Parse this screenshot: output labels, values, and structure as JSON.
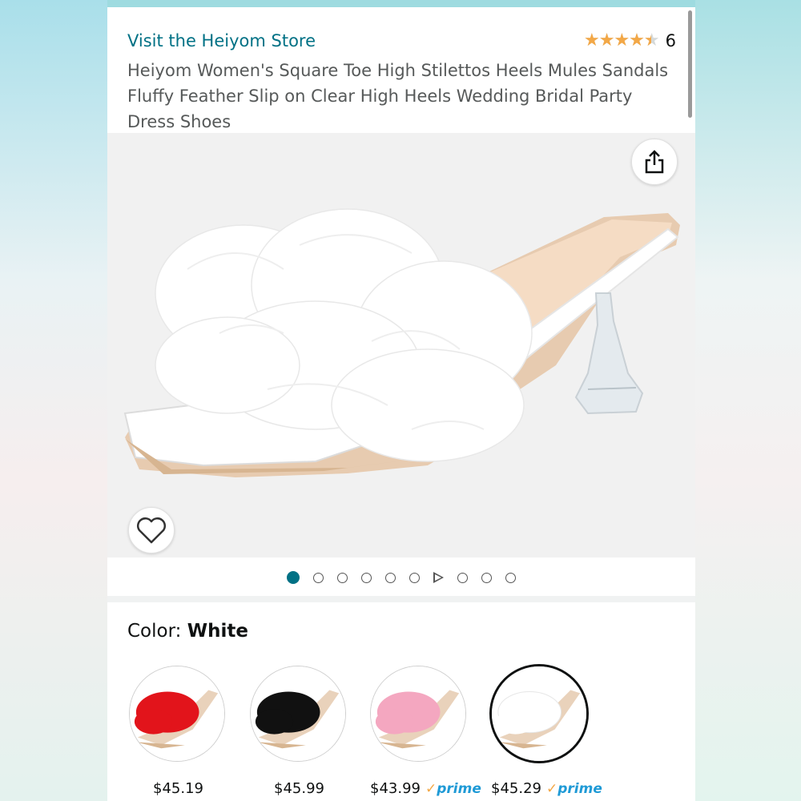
{
  "header": {
    "store_link": "Visit the Heiyom Store",
    "rating_value": 4.5,
    "rating_count": "6",
    "title": "Heiyom Women's Square Toe High Stilettos Heels Mules Sandals Fluffy Feather Slip on Clear High Heels Wedding Bridal Party Dress Shoes"
  },
  "gallery": {
    "total_slides": 10,
    "active_index": 0,
    "video_index": 6,
    "icons": {
      "share": "share-icon",
      "wishlist": "heart-icon"
    }
  },
  "color": {
    "label": "Color: ",
    "selected": "White"
  },
  "variants": [
    {
      "name": "Red",
      "price": "$45.19",
      "prime": "",
      "color": "#e2141b",
      "selected": false
    },
    {
      "name": "Black",
      "price": "$45.99",
      "prime": "",
      "color": "#111111",
      "selected": false
    },
    {
      "name": "Pink",
      "price": "$43.99",
      "prime": "prime",
      "color": "#f4a7c0",
      "selected": false
    },
    {
      "name": "White",
      "price": "$45.29",
      "prime": "prime",
      "color": "#ffffff",
      "selected": true
    }
  ],
  "colors": {
    "link": "#007185",
    "star": "#f3a847",
    "prime_blue": "#1f9ad6"
  }
}
